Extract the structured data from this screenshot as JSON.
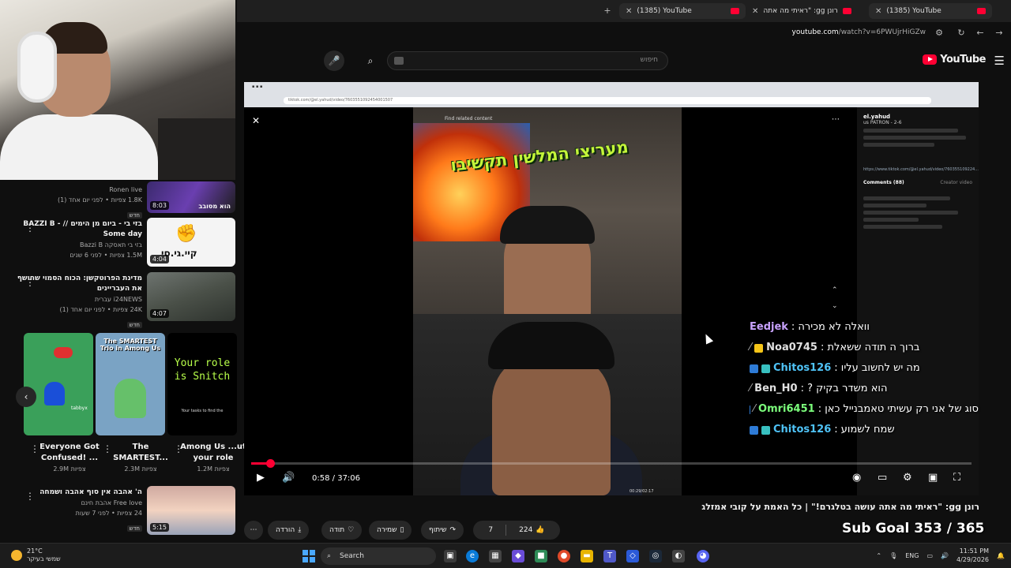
{
  "browser": {
    "tabs": [
      {
        "title": "(1385) YouTube"
      },
      {
        "title": "רונן gg: \"ראיתי מה אתה"
      },
      {
        "title": "(1385) YouTube"
      }
    ],
    "url_domain": "youtube.com",
    "url_path": "/watch?v=6PWUjrHiGZw"
  },
  "youtube": {
    "logo_text": "YouTube",
    "search_placeholder": "חיפוש"
  },
  "sidebar": {
    "videos": [
      {
        "title": "Ronen live",
        "meta": "1.8K צפיות • לפני יום אחד (1)",
        "badge": "חדש",
        "duration": "8:03",
        "thumb_text": "הוא מסובב"
      },
      {
        "title": "בזי בי - ביום מן הימים // BAZZI B - Some day",
        "channel": "בזי בי תאסקה Bazzi B",
        "meta": "1.5M צפיות • לפני 6 שנים",
        "duration": "4:04",
        "thumb_text": "קיי.גי.סי"
      },
      {
        "title": "מדינת הפרוטקשן: הכוח הסמוי שחושף את העבריינים",
        "channel": "i24NEWS עברית",
        "meta": "24K צפיות • לפני יום אחד (1)",
        "badge": "חדש",
        "duration": "4:07"
      },
      {
        "title": "ה' אהבה אין סוף אהבה ושמחה",
        "channel": "Free love אהבת חינם",
        "meta": "24 צפיות • לפני 7 שעות",
        "badge": "חדש",
        "duration": "5:15"
      }
    ],
    "shorts": [
      {
        "title": "Everyone Got Confused! ...",
        "views": "2.9M צפיות",
        "thumb_text": "tabbyx"
      },
      {
        "title": "The SMARTEST...",
        "views": "2.3M צפיות",
        "thumb_text": "The SMARTEST Trio in Among Us"
      },
      {
        "title": "Among Us ...ut your role",
        "views": "1.2M צפיות",
        "thumb_text": "Your role is Snitch",
        "thumb_sub": "Your tasks to find the"
      }
    ]
  },
  "player": {
    "inner_url": "tiktok.com/@el.yahud/video/7603551092454001507",
    "find_related": "Find related content",
    "caption": "מעריצי המלשין תקשיבו",
    "tt_author": "el.yahud",
    "tt_subtitle": "us PATRON - 2-6",
    "tt_link": "https://www.tiktok.com/@el.yahud/video/760355109224...",
    "tt_comments": "Comments (88)",
    "tt_creator": "Creator video",
    "current_time": "0:58",
    "duration": "37:06",
    "progress_fraction": 0.026,
    "inner_time": "00:29/02:17"
  },
  "chat": [
    {
      "name": "Eedjek",
      "message": "וואלה לא מכירה :",
      "color": "#c8a2ff"
    },
    {
      "name": "Noa0745",
      "message": "ברוך ה תודה ששאלת :",
      "color": "#e0e0e0"
    },
    {
      "name": "Chitos126",
      "message": "מה יש לחשוב עליו :",
      "color": "#4fc3f7"
    },
    {
      "name": "Ben_H0",
      "message": "הוא משדר בקיק ? :",
      "color": "#e0e0e0"
    },
    {
      "name": "Omri6451",
      "message": "סוג של אני רק עשיתי טאמבנייל כאן :",
      "color": "#7cff7c"
    },
    {
      "name": "Chitos126",
      "message": "שמח לשמוע :",
      "color": "#4fc3f7"
    }
  ],
  "video": {
    "title": "רונן gg: \"ראיתי מה אתה עושה בטלגרם!\" | כל האמת על קובי אמזלג",
    "likes": "224",
    "dislikes": "7",
    "share": "שיתוף",
    "save": "שמירה",
    "thanks": "תודה",
    "download": "הורדה",
    "sub_goal": "Sub Goal 353 / 365"
  },
  "taskbar": {
    "temp": "21°C",
    "weather_desc": "שמשי בעיקר",
    "search": "Search",
    "lang": "ENG",
    "time": "11:51 PM",
    "date": "4/29/2026"
  }
}
